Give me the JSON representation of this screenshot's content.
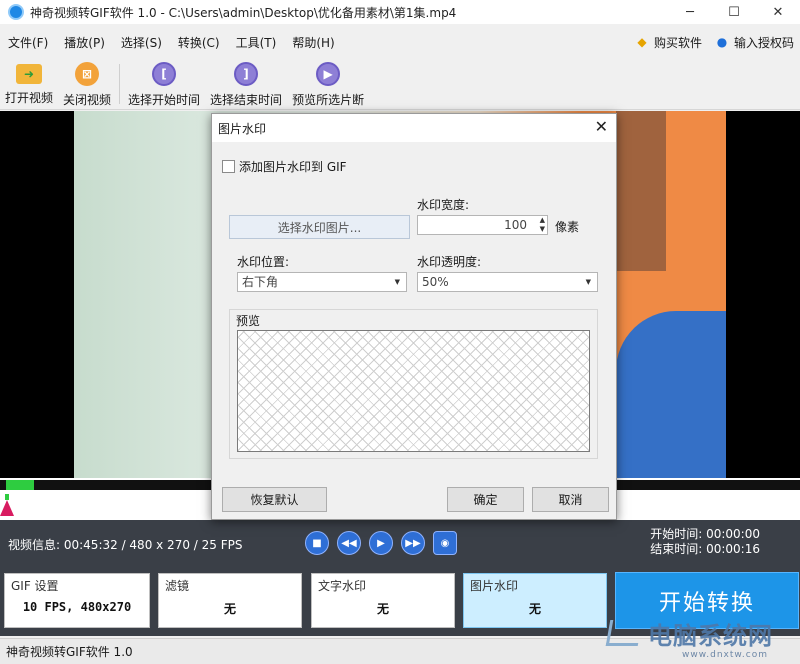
{
  "window": {
    "title": "神奇视频转GIF软件 1.0 - C:\\Users\\admin\\Desktop\\优化备用素材\\第1集.mp4",
    "minimize": "─",
    "maximize": "☐",
    "close": "✕"
  },
  "menu": {
    "items": [
      "文件(F)",
      "播放(P)",
      "选择(S)",
      "转换(C)",
      "工具(T)",
      "帮助(H)"
    ],
    "buy": "购买软件",
    "license": "输入授权码",
    "buy_icon": "diamond-icon",
    "license_icon": "user-icon"
  },
  "toolbar": {
    "open": "打开视频",
    "close": "关闭视频",
    "select_start": "选择开始时间",
    "select_end": "选择结束时间",
    "preview": "预览所选片断"
  },
  "dialog": {
    "title": "图片水印",
    "add_checkbox": "添加图片水印到 GIF",
    "add_checked": false,
    "choose_button": "选择水印图片...",
    "width_label": "水印宽度:",
    "width_value": "100",
    "unit": "像素",
    "position_label": "水印位置:",
    "position_value": "右下角",
    "opacity_label": "水印透明度:",
    "opacity_value": "50%",
    "preview_label": "预览",
    "reset_button": "恢复默认",
    "ok_button": "确定",
    "cancel_button": "取消"
  },
  "info": {
    "video_info": "视频信息: 00:45:32 / 480 x 270 / 25 FPS",
    "start_label": "开始时间:",
    "start_value": "00:00:00",
    "end_label": "结束时间:",
    "end_value": "00:00:16"
  },
  "settings": {
    "gif_title": "GIF 设置",
    "gif_value": "10 FPS, 480x270",
    "filter_title": "滤镜",
    "filter_value": "无",
    "text_title": "文字水印",
    "text_value": "无",
    "image_title": "图片水印",
    "image_value": "无",
    "start_button": "开始转换"
  },
  "status": {
    "text": "神奇视频转GIF软件 1.0"
  },
  "watermark": {
    "text": "电脑系统网",
    "url": "www.dnxtw.com"
  },
  "colors": {
    "accent": "#1d95e8",
    "panel": "#3a3f47",
    "progress": "#2ecc40"
  }
}
